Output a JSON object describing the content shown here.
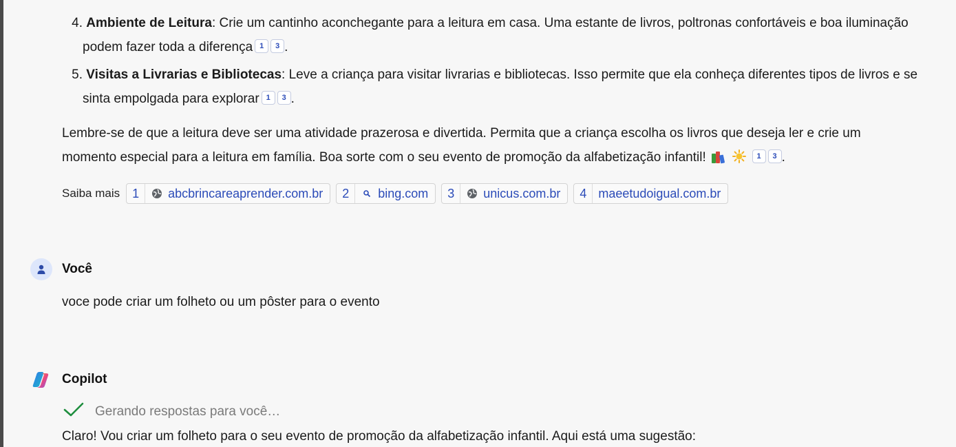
{
  "list_items": [
    {
      "number": "4.",
      "title": "Ambiente de Leitura",
      "text": ": Crie um cantinho aconchegante para a leitura em casa. Uma estante de livros, poltronas confortáveis e boa iluminação podem fazer toda a diferença",
      "citations": [
        "1",
        "3"
      ],
      "end": "."
    },
    {
      "number": "5.",
      "title": "Visitas a Livrarias e Bibliotecas",
      "text": ": Leve a criança para visitar livrarias e bibliotecas. Isso permite que ela conheça diferentes tipos de livros e se sinta empolgada para explorar",
      "citations": [
        "1",
        "3"
      ],
      "end": "."
    }
  ],
  "closing": {
    "text": "Lembre-se de que a leitura deve ser uma atividade prazerosa e divertida. Permita que a criança escolha os livros que deseja ler e crie um momento especial para a leitura em família. Boa sorte com o seu evento de promoção da alfabetização infantil!",
    "emojis": [
      "books-emoji",
      "sun-emoji"
    ],
    "citations": [
      "1",
      "3"
    ],
    "end": "."
  },
  "learn_more": {
    "label": "Saiba mais",
    "sources": [
      {
        "num": "1",
        "icon": "globe-icon",
        "domain": "abcbrincareaprender.com.br"
      },
      {
        "num": "2",
        "icon": "search-icon",
        "domain": "bing.com"
      },
      {
        "num": "3",
        "icon": "globe-icon",
        "domain": "unicus.com.br"
      },
      {
        "num": "4",
        "icon": "none",
        "domain": "maeetudoigual.com.br"
      }
    ]
  },
  "user_message": {
    "author": "Você",
    "avatar_icon": "person-icon",
    "text": "voce pode criar um folheto ou um pôster para o evento"
  },
  "copilot_message": {
    "author": "Copilot",
    "logo_icon": "copilot-logo-icon",
    "status_icon": "check-icon",
    "status": "Gerando respostas para você…",
    "text": "Claro! Vou criar um folheto para o seu evento de promoção da alfabetização infantil. Aqui está uma sugestão:"
  },
  "colors": {
    "background": "#f7f7f7",
    "link": "#2b4bb8",
    "check": "#1e8e3e",
    "status_text": "#7a7a7a"
  }
}
